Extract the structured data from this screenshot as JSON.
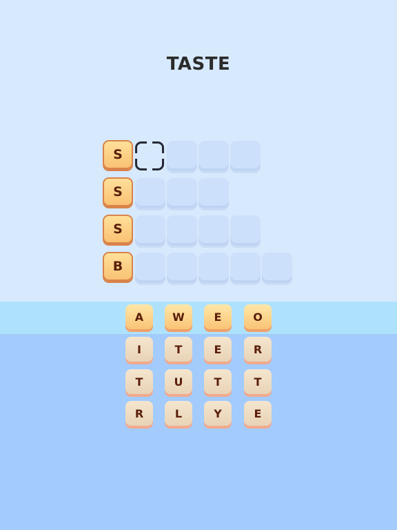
{
  "title": "TASTE",
  "board": {
    "rows": [
      {
        "lead": "S",
        "empty_cells": 4,
        "cursor_index": 0
      },
      {
        "lead": "S",
        "empty_cells": 3,
        "cursor_index": -1
      },
      {
        "lead": "S",
        "empty_cells": 4,
        "cursor_index": -1
      },
      {
        "lead": "B",
        "empty_cells": 5,
        "cursor_index": -1
      }
    ]
  },
  "letters": {
    "rows": [
      {
        "state": "active",
        "tiles": [
          "A",
          "W",
          "E",
          "O"
        ]
      },
      {
        "state": "idle",
        "tiles": [
          "I",
          "T",
          "E",
          "R"
        ]
      },
      {
        "state": "idle",
        "tiles": [
          "T",
          "U",
          "T",
          "T"
        ]
      },
      {
        "state": "idle",
        "tiles": [
          "R",
          "L",
          "Y",
          "E"
        ]
      }
    ]
  },
  "colors": {
    "background": "#d7e9fc",
    "band": "#aee2fc",
    "lower": "#a3cbfb",
    "tile_text": "#5a1e0a"
  }
}
